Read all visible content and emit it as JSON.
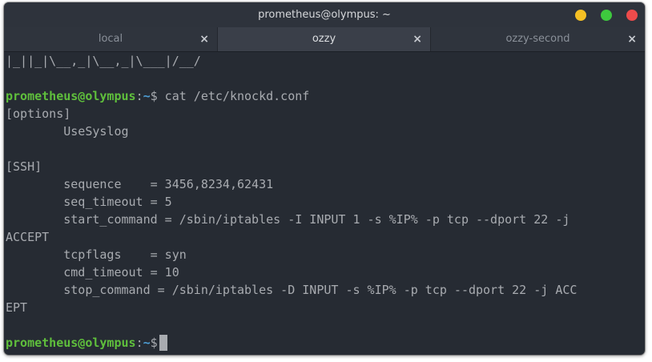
{
  "window": {
    "title": "prometheus@olympus: ~",
    "controls": {
      "minimize_color": "#f5c024",
      "maximize_color": "#3ec93e",
      "close_color": "#ed4b4b"
    }
  },
  "tabs": [
    {
      "label": "local",
      "active": false,
      "close_icon": "×"
    },
    {
      "label": "ozzy",
      "active": true,
      "close_icon": "×"
    },
    {
      "label": "ozzy-second",
      "active": false,
      "close_icon": "×"
    }
  ],
  "terminal": {
    "prompt": {
      "user_host": "prometheus@olympus",
      "sep": ":",
      "path": "~",
      "symbol": "$"
    },
    "line_banner": "|_||_|\\__,_|\\__,_|\\___|/__/",
    "command": " cat /etc/knockd.conf",
    "output": {
      "l1": "[options]",
      "l2": "        UseSyslog",
      "l3": "",
      "l4": "[SSH]",
      "l5": "        sequence    = 3456,8234,62431",
      "l6": "        seq_timeout = 5",
      "l7": "        start_command = /sbin/iptables -I INPUT 1 -s %IP% -p tcp --dport 22 -j",
      "l8": "ACCEPT",
      "l9": "        tcpflags    = syn",
      "l10": "        cmd_timeout = 10",
      "l11": "        stop_command = /sbin/iptables -D INPUT -s %IP% -p tcp --dport 22 -j ACC",
      "l12": "EPT"
    },
    "colors": {
      "user_host": "#5fbf3c",
      "path": "#4d9fd6",
      "text": "#a8abb0",
      "background": "#262b33"
    }
  }
}
